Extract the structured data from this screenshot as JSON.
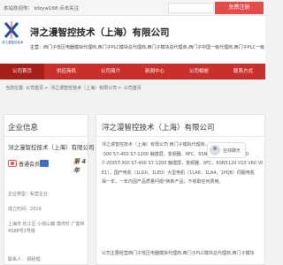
{
  "topbar": {
    "welcome": "本站欢迎你： bfzyw168 点击关注",
    "register": "免费注册"
  },
  "header": {
    "logo_caption": "浔之漫智控技术（上海）",
    "company_name": "浔之漫智控技术（上海）有限公司",
    "main_biz_label": "主营：",
    "main_biz": "西门子低压电器模拟代理商,西门子PLC模块总代理商,西门子模块总代理商,西门子中国一级代理商,西门子PLC一级"
  },
  "nav": [
    "公司首页",
    "供应商机",
    "公司简介",
    "新闻中心",
    "公司相册",
    "联系方式"
  ],
  "breadcrumb": [
    "当前位置:",
    "公司首页",
    "浔之漫智控技术（上海）有限公司",
    "公司首页"
  ],
  "sidebar": {
    "title": "企业信息",
    "company": "浔之漫智控技术（上海）有限公司",
    "badge_text": "普通会员",
    "years": "第 4 年",
    "rows": [
      {
        "label": "企业类型：",
        "value": "私营企业"
      },
      {
        "label": "成立时间：",
        "value": "2019"
      }
    ],
    "address": "上海市 松江区 小昆山镇 荡湾村 广富林4588号2号楼",
    "contact": "联系人：  顾经理"
  },
  "main": {
    "title": "浔之漫智控技术（上海）有限公司",
    "desc": [
      "浔之漫智控技术（上海）有限公司 西门子模拟代理商，本公司主营：S7",
      "-300 S7-400 S7-1200 触摸屏、变频器、6FC、6SN5120 V10 V60 V80",
      "7-200ST-300 S7-400 S7-1200 触摸屏，变频器、6FC、6SN5120 V10 V60 V80",
      "E1），国产电机（1LG0，1LE0）大型电机（1LA8，1LA4，1PQ8）伺服电机",
      "保一年，一年内因产品质量问题*换新产品；不收取任何费用。"
    ],
    "more": "公司主要经营西门子低压电器模拟代理商,西门子PLC模块总代理商,西门子模块"
  },
  "chat": {
    "name": "在线聊天"
  },
  "colors": {
    "nav": "#c9302c",
    "brand": "#e44c4c"
  }
}
